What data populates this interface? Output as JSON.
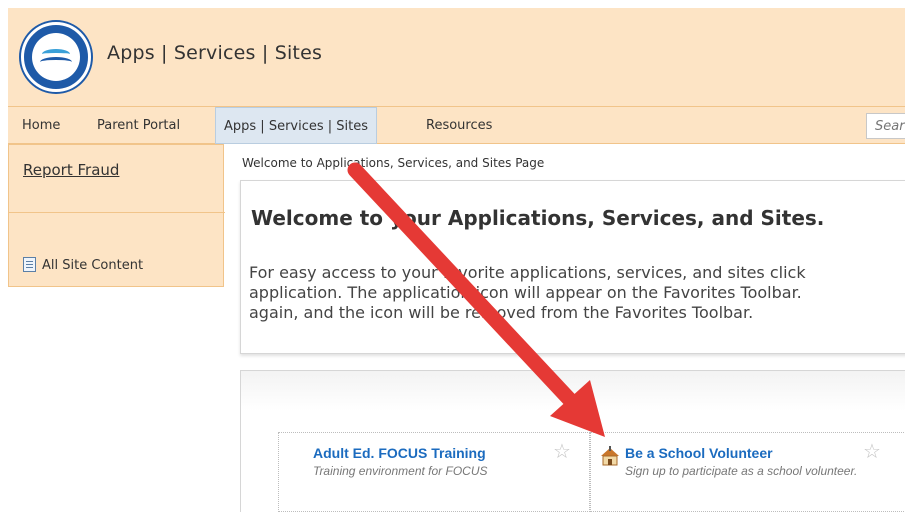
{
  "header": {
    "site_title": "Apps | Services | Sites"
  },
  "topnav": {
    "items": [
      {
        "label": "Home"
      },
      {
        "label": "Parent Portal"
      },
      {
        "label": "Apps | Services | Sites",
        "selected": true
      },
      {
        "label": "Resources"
      }
    ],
    "search_placeholder": "Sear"
  },
  "sidebar": {
    "report_fraud": "Report Fraud",
    "all_site_content": "All Site Content"
  },
  "breadcrumb": "Welcome to Applications, Services, and Sites Page",
  "welcome": {
    "title": "Welcome to your Applications, Services, and Sites.",
    "lines": [
      "For easy access to your favorite applications, services, and sites click",
      "application. The application icon will appear on the Favorites Toolbar.",
      "again, and the icon will be removed from the Favorites Toolbar."
    ]
  },
  "apps": [
    {
      "title": "Adult Ed. FOCUS Training",
      "description": "Training environment for FOCUS",
      "icon": "none"
    },
    {
      "title": "Be a School Volunteer",
      "description": "Sign up to participate as a school volunteer.",
      "icon": "school-house-icon"
    }
  ],
  "colors": {
    "header_bg": "#fde4c5",
    "nav_selected_bg": "#dde7f1",
    "link_blue": "#1b6bbf",
    "annotation_arrow": "#e53935"
  }
}
